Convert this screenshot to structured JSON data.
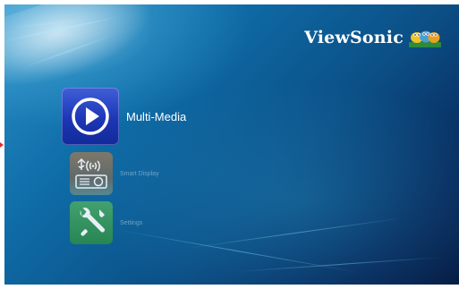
{
  "brand": {
    "logo_text": "ViewSonic",
    "logo_icon": "viewsonic-birds-icon"
  },
  "menu": {
    "items": [
      {
        "label": "Multi-Media",
        "icon": "play-icon",
        "selected": true,
        "color": "#1c36b5"
      },
      {
        "label": "Smart Display",
        "icon": "usb-wifi-projector-icon",
        "selected": false,
        "color": "#7a7a6e"
      },
      {
        "label": "Settings",
        "icon": "tools-icon",
        "selected": false,
        "color": "#2b8a4c"
      }
    ]
  },
  "colors": {
    "background_light": "#2a8fc7",
    "background_dark": "#061d44",
    "marker": "#e0312a"
  }
}
